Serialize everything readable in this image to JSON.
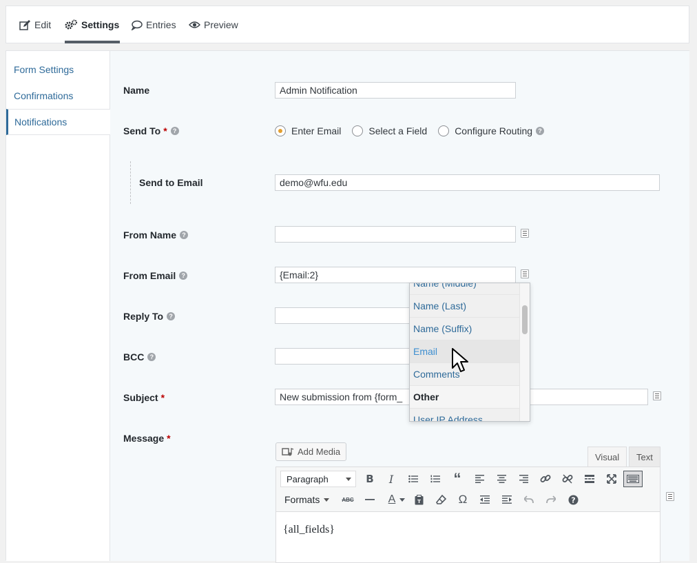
{
  "tabs": [
    {
      "label": "Edit",
      "icon": "pencil-square-icon"
    },
    {
      "label": "Settings",
      "icon": "gears-icon",
      "active": true
    },
    {
      "label": "Entries",
      "icon": "speech-bubble-icon"
    },
    {
      "label": "Preview",
      "icon": "eye-icon"
    }
  ],
  "sidebar": {
    "items": [
      {
        "label": "Form Settings"
      },
      {
        "label": "Confirmations"
      },
      {
        "label": "Notifications",
        "active": true
      }
    ]
  },
  "form": {
    "name_label": "Name",
    "name_value": "Admin Notification",
    "send_to_label": "Send To",
    "send_to_options": [
      "Enter Email",
      "Select a Field",
      "Configure Routing"
    ],
    "send_to_selected": "Enter Email",
    "send_to_email_label": "Send to Email",
    "send_to_email_value": "demo@wfu.edu",
    "from_name_label": "From Name",
    "from_name_value": "",
    "from_email_label": "From Email",
    "from_email_value": "{Email:2}",
    "reply_to_label": "Reply To",
    "reply_to_value": "",
    "bcc_label": "BCC",
    "bcc_value": "",
    "subject_label": "Subject",
    "subject_value": "New submission from {form_",
    "message_label": "Message",
    "required_mark": "*",
    "help_glyph": "?"
  },
  "merge_dropdown": {
    "partial_top": "Name (Middle)",
    "items": [
      "Name (Last)",
      "Name (Suffix)",
      "Email",
      "Comments"
    ],
    "hovered": "Email",
    "group_label": "Other",
    "partial_bottom": "User IP Address"
  },
  "editor": {
    "add_media_label": "Add Media",
    "tab_visual": "Visual",
    "tab_text": "Text",
    "format_select": "Paragraph",
    "formats_menu": "Formats",
    "content": "{all_fields}"
  },
  "colors": {
    "accent": "#2e6a99",
    "radio_selected": "#e39f2f",
    "required": "#bb0000",
    "content_bg": "#f5f9fb"
  }
}
